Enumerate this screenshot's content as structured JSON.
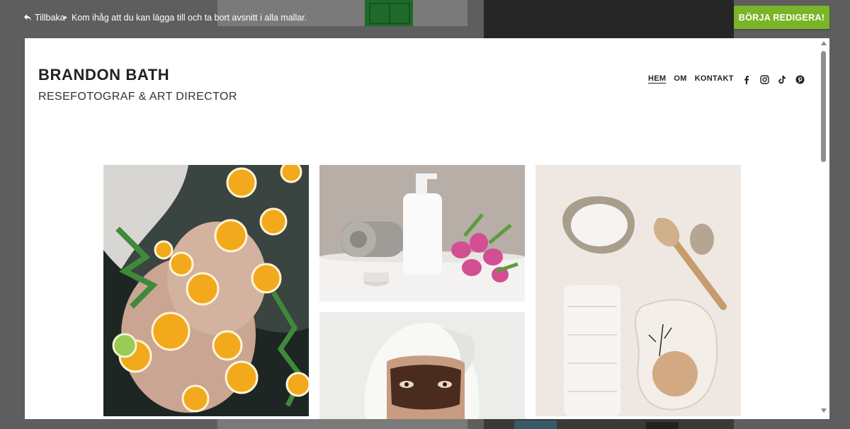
{
  "topbar": {
    "back_label": "Tillbaka",
    "separator": "•",
    "hint": "Kom ihåg att du kan lägga till och ta bort avsnitt i alla mallar.",
    "start_button": "BÖRJA REDIGERA!",
    "accent": "#7ab528"
  },
  "site": {
    "name": "BRANDON BATH",
    "tagline": "RESEFOTOGRAF & ART DIRECTOR",
    "nav": [
      {
        "label": "HEM",
        "active": true
      },
      {
        "label": "OM",
        "active": false
      },
      {
        "label": "KONTAKT",
        "active": false
      }
    ],
    "socials": [
      "facebook-icon",
      "instagram-icon",
      "tiktok-icon",
      "pinterest-icon"
    ]
  },
  "gallery": {
    "photos": [
      {
        "name": "orange-slices-bath-photo"
      },
      {
        "name": "towel-soap-tulips-photo"
      },
      {
        "name": "face-mask-towel-photo"
      },
      {
        "name": "salt-brush-soap-photo"
      }
    ]
  }
}
